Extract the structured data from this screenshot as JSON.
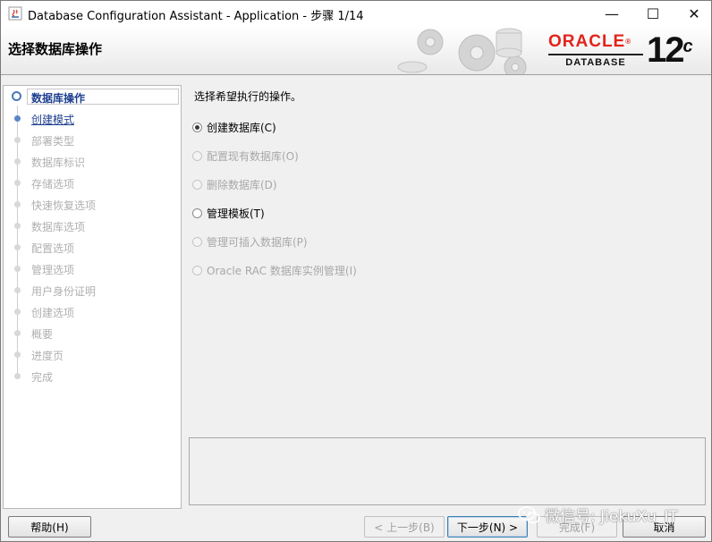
{
  "window": {
    "title": "Database Configuration Assistant - Application - 步骤 1/14",
    "controls": {
      "minimize": "—",
      "maximize": "☐",
      "close": "✕"
    }
  },
  "banner": {
    "title": "选择数据库操作",
    "logo_oracle": "ORACLE",
    "logo_registered": "®",
    "logo_database": "DATABASE",
    "version": "12",
    "version_suffix": "c"
  },
  "nav": {
    "items": [
      {
        "label": "数据库操作",
        "state": "active"
      },
      {
        "label": "创建模式",
        "state": "next"
      },
      {
        "label": "部署类型",
        "state": "disabled"
      },
      {
        "label": "数据库标识",
        "state": "disabled"
      },
      {
        "label": "存储选项",
        "state": "disabled"
      },
      {
        "label": "快速恢复选项",
        "state": "disabled"
      },
      {
        "label": "数据库选项",
        "state": "disabled"
      },
      {
        "label": "配置选项",
        "state": "disabled"
      },
      {
        "label": "管理选项",
        "state": "disabled"
      },
      {
        "label": "用户身份证明",
        "state": "disabled"
      },
      {
        "label": "创建选项",
        "state": "disabled"
      },
      {
        "label": "概要",
        "state": "disabled"
      },
      {
        "label": "进度页",
        "state": "disabled"
      },
      {
        "label": "完成",
        "state": "disabled"
      }
    ]
  },
  "content": {
    "prompt": "选择希望执行的操作。",
    "options": [
      {
        "label": "创建数据库(C)",
        "selected": true,
        "enabled": true
      },
      {
        "label": "配置现有数据库(O)",
        "selected": false,
        "enabled": false
      },
      {
        "label": "删除数据库(D)",
        "selected": false,
        "enabled": false
      },
      {
        "label": "管理模板(T)",
        "selected": false,
        "enabled": true
      },
      {
        "label": "管理可插入数据库(P)",
        "selected": false,
        "enabled": false
      },
      {
        "label": "Oracle RAC 数据库实例管理(I)",
        "selected": false,
        "enabled": false
      }
    ]
  },
  "buttons": {
    "help": "帮助(H)",
    "back": "< 上一步(B)",
    "next": "下一步(N) >",
    "finish": "完成(F)",
    "cancel": "取消"
  },
  "watermark": {
    "text": "微信号: JiekuXu_IT"
  },
  "colors": {
    "oracle_red": "#e2231a",
    "nav_active": "#1f3f8f",
    "disabled_text": "#a8a8a8"
  }
}
